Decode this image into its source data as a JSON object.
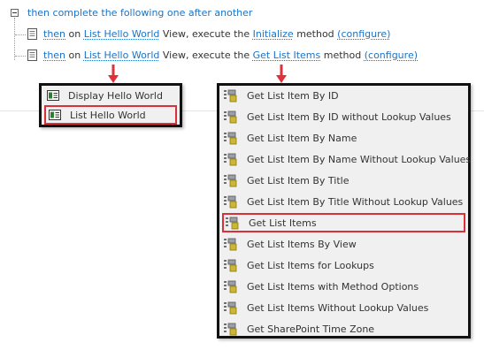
{
  "rule": {
    "heading": "then complete the following one after another",
    "actions": [
      {
        "then": "then",
        "on": "on",
        "target": "List Hello World",
        "view_execute": "View, execute the",
        "method_name": "Initialize",
        "method_word": "method",
        "configure": "(configure)"
      },
      {
        "then": "then",
        "on": "on",
        "target": "List Hello World",
        "view_execute": "View, execute the",
        "method_name": "Get List Items",
        "method_word": "method",
        "configure": "(configure)"
      }
    ]
  },
  "view_menu": {
    "items": [
      {
        "label": "Display Hello World",
        "highlighted": false
      },
      {
        "label": "List Hello World",
        "highlighted": true
      }
    ]
  },
  "method_menu": {
    "items": [
      {
        "label": "Get List Item By ID",
        "highlighted": false
      },
      {
        "label": "Get List Item By ID without Lookup Values",
        "highlighted": false
      },
      {
        "label": "Get List Item By Name",
        "highlighted": false
      },
      {
        "label": "Get List Item By Name Without Lookup Values",
        "highlighted": false
      },
      {
        "label": "Get List Item By Title",
        "highlighted": false
      },
      {
        "label": "Get List Item By Title Without Lookup Values",
        "highlighted": false
      },
      {
        "label": "Get List Items",
        "highlighted": true
      },
      {
        "label": "Get List Items By View",
        "highlighted": false
      },
      {
        "label": "Get List Items for Lookups",
        "highlighted": false
      },
      {
        "label": "Get List Items with Method Options",
        "highlighted": false
      },
      {
        "label": "Get List Items Without Lookup Values",
        "highlighted": false
      },
      {
        "label": "Get SharePoint Time Zone",
        "highlighted": false
      }
    ]
  },
  "colors": {
    "link": "#1a73c8",
    "highlight": "#d9303a",
    "menu_bg": "#f0f0f0",
    "menu_border": "#111111"
  },
  "icons": {
    "expander": "collapse-minus-icon",
    "action": "document-icon",
    "view": "view-form-icon",
    "method": "method-cube-icon",
    "arrow": "red-arrow-down-icon"
  }
}
